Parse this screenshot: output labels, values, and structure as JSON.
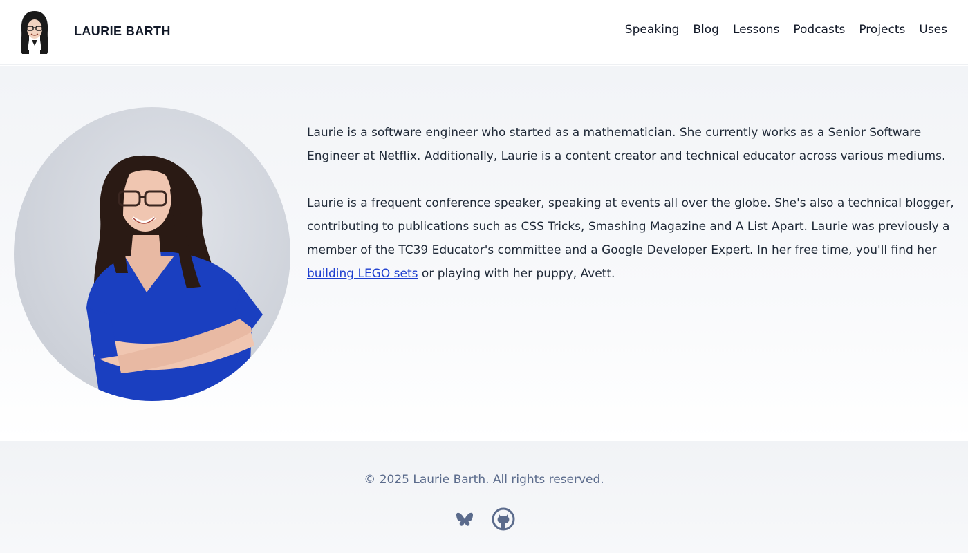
{
  "header": {
    "site_title": "LAURIE BARTH",
    "logo_icon": "avatar-illustration-icon",
    "nav": [
      {
        "label": "Speaking"
      },
      {
        "label": "Blog"
      },
      {
        "label": "Lessons"
      },
      {
        "label": "Podcasts"
      },
      {
        "label": "Projects"
      },
      {
        "label": "Uses"
      }
    ]
  },
  "bio": {
    "paragraph_1": "Laurie is a software engineer who started as a mathematician. She currently works as a Senior Software Engineer at Netflix. Additionally, Laurie is a content creator and technical educator across various mediums.",
    "paragraph_2_before": "Laurie is a frequent conference speaker, speaking at events all over the globe. She's also a technical blogger, contributing to publications such as CSS Tricks, Smashing Magazine and A List Apart. Laurie was previously a member of the TC39 Educator's committee and a Google Developer Expert. In her free time, you'll find her ",
    "paragraph_2_link": "building LEGO sets",
    "paragraph_2_after": " or playing with her puppy, Avett."
  },
  "footer": {
    "copyright": "© 2025 Laurie Barth. All rights reserved.",
    "social_icons": [
      "bluesky-icon",
      "github-icon"
    ],
    "icon_color": "#5b6b8c"
  },
  "colors": {
    "link": "#1d3ecf",
    "text": "#1f2937",
    "shirt": "#1a3fc0"
  }
}
